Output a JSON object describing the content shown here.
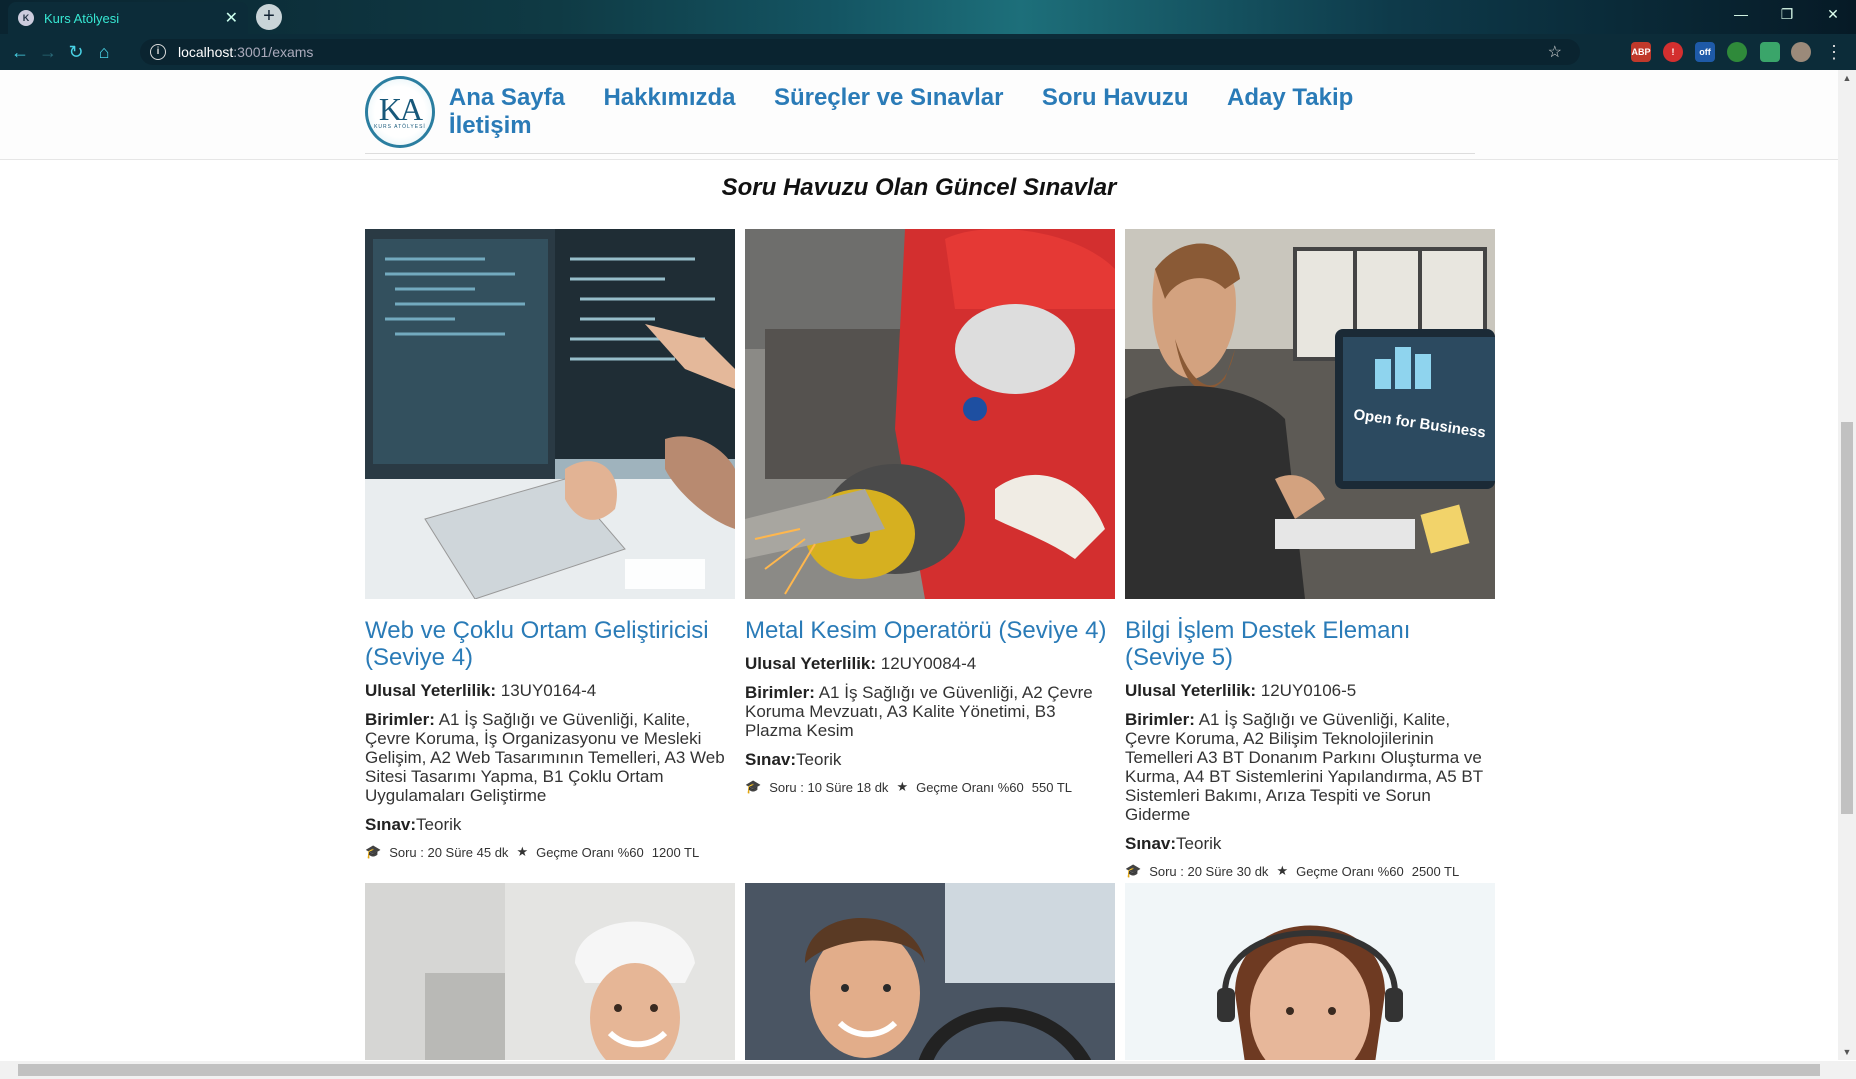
{
  "browser": {
    "tab_title": "Kurs Atölyesi",
    "url_host": "localhost",
    "url_path": ":3001/exams",
    "extensions": [
      "ABP",
      "!",
      "off",
      "",
      "",
      ""
    ]
  },
  "header": {
    "logo_text": "KA",
    "logo_sub": "KURS ATÖLYESİ",
    "nav": [
      "Ana Sayfa",
      "Hakkımızda",
      "Süreçler ve Sınavlar",
      "Soru Havuzu",
      "Aday Takip",
      "İletişim"
    ]
  },
  "section_title": "Soru Havuzu Olan Güncel Sınavlar",
  "labels": {
    "qualification": "Ulusal Yeterlilik:",
    "units": "Birimler:",
    "exam": "Sınav:"
  },
  "exams": [
    {
      "name": "Web ve Çoklu Ortam Geliştiricisi (Seviye 4)",
      "qualification": "13UY0164-4",
      "units": "A1 İş Sağlığı ve Güvenliği, Kalite, Çevre Koruma, İş Organizasyonu ve Mesleki Gelişim, A2 Web Tasarımının Temelleri, A3 Web Sitesi Tasarımı Yapma, B1 Çoklu Ortam Uygulamaları Geliştirme",
      "exam_type": "Teorik",
      "questions": "Soru : 20 Süre 45 dk",
      "pass_rate": "Geçme Oranı %60",
      "price": "1200 TL"
    },
    {
      "name": "Metal Kesim Operatörü (Seviye 4)",
      "qualification": "12UY0084-4",
      "units": "A1 İş Sağlığı ve Güvenliği, A2 Çevre Koruma Mevzuatı, A3 Kalite Yönetimi, B3 Plazma Kesim",
      "exam_type": "Teorik",
      "questions": "Soru : 10 Süre 18 dk",
      "pass_rate": "Geçme Oranı %60",
      "price": "550 TL"
    },
    {
      "name": "Bilgi İşlem Destek Elemanı (Seviye 5)",
      "qualification": "12UY0106-5",
      "units": "A1 İş Sağlığı ve Güvenliği, Kalite, Çevre Koruma, A2 Bilişim Teknolojilerinin Temelleri A3 BT Donanım Parkını Oluşturma ve Kurma, A4 BT Sistemlerini Yapılandırma, A5 BT Sistemleri Bakımı, Arıza Tespiti ve Sorun Giderme",
      "exam_type": "Teorik",
      "questions": "Soru : 20 Süre 30 dk",
      "pass_rate": "Geçme Oranı %60",
      "price": "2500 TL"
    }
  ],
  "image_texts": {
    "open_for_business": "Open for Business"
  },
  "colors": {
    "link": "#2a7bb7",
    "chrome_dark": "#0c2c39",
    "tab_text": "#37e8d3"
  }
}
